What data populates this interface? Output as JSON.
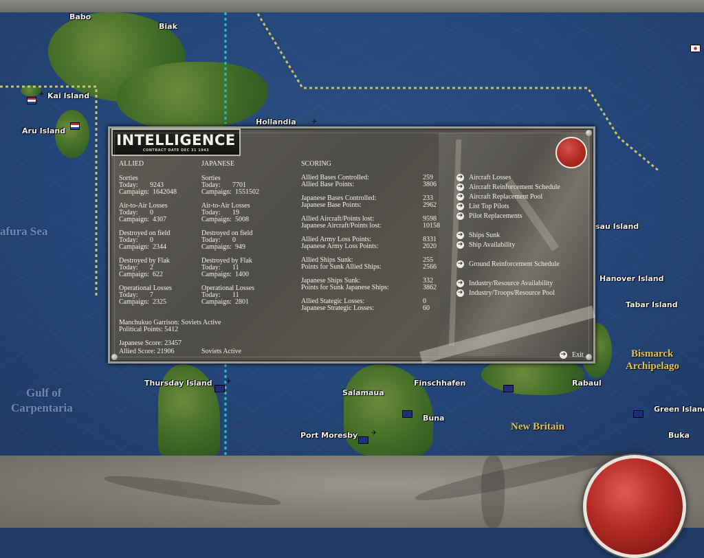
{
  "map": {
    "labels": {
      "babo": "Babo",
      "biak": "Biak",
      "kai_island": "Kai Island",
      "aru_island": "Aru Island",
      "hollandia": "Hollandia",
      "arafura_sea": "afura Sea",
      "thursday_island": "Thursday Island",
      "gulf_of_carpentaria_1": "Gulf of",
      "gulf_of_carpentaria_2": "Carpentaria",
      "salamaua": "Salamaua",
      "finschhafen": "Finschhafen",
      "buna": "Buna",
      "port_moresby": "Port Moresby",
      "new_britain": "New Britain",
      "rabaul": "Rabaul",
      "green_island": "Green Island",
      "buka": "Buka",
      "hanover_island": "Hanover Island",
      "tabar_island": "Tabar Island",
      "bismarck_1": "Bismarck",
      "bismarck_2": "Archipelago",
      "manus_island": "sau Island"
    }
  },
  "dialog": {
    "title": "INTELLIGENCE",
    "subtitle": "CONTRACT DATE DEC 31 1943",
    "allied": {
      "header": "ALLIED",
      "sorties_label": "Sorties",
      "sorties_today": "9243",
      "sorties_campaign": "1642048",
      "a2a_label": "Air-to-Air Losses",
      "a2a_today": "0",
      "a2a_campaign": "4307",
      "dof_label": "Destroyed on field",
      "dof_today": "0",
      "dof_campaign": "2344",
      "flak_label": "Destroyed by Flak",
      "flak_today": "2",
      "flak_campaign": "622",
      "ops_label": "Operational Losses",
      "ops_today": "7",
      "ops_campaign": "2325"
    },
    "japanese": {
      "header": "JAPANESE",
      "sorties_label": "Sorties",
      "sorties_today": "7701",
      "sorties_campaign": "1551502",
      "a2a_label": "Air-to-Air Losses",
      "a2a_today": "19",
      "a2a_campaign": "5008",
      "dof_label": "Destroyed on field",
      "dof_today": "0",
      "dof_campaign": "949",
      "flak_label": "Destroyed by Flak",
      "flak_today": "11",
      "flak_campaign": "1400",
      "ops_label": "Operational Losses",
      "ops_today": "11",
      "ops_campaign": "2801"
    },
    "today_label": "Today:",
    "campaign_label": "Campaign:",
    "manchukuo": "Manchukuo Garrison: Soviets Active",
    "political_points": "Political Points: 5412",
    "japanese_score": "Japanese Score: 23457",
    "allied_score": "Allied Score: 21906",
    "soviets_active": "Soviets Active",
    "scoring": {
      "header": "SCORING",
      "rows": [
        {
          "label": "Allied Bases Controlled:",
          "value": "259"
        },
        {
          "label": "Allied Base Points:",
          "value": "3806"
        },
        {
          "label": "Japanese Bases Controlled:",
          "value": "233"
        },
        {
          "label": "Japanese Base Points:",
          "value": "2962"
        },
        {
          "label": "Allied Aircraft/Points lost:",
          "value": "9598"
        },
        {
          "label": "Japanese Aircraft/Points lost:",
          "value": "10158"
        },
        {
          "label": "Allied Army Loss Points:",
          "value": "8331"
        },
        {
          "label": "Japanese Army Loss Points:",
          "value": "2020"
        },
        {
          "label": "Allied Ships Sunk:",
          "value": "255"
        },
        {
          "label": "Points for Sunk Allied Ships:",
          "value": "2566"
        },
        {
          "label": "Japanese Ships Sunk:",
          "value": "332"
        },
        {
          "label": "Points for Sunk Japanese Ships:",
          "value": "3862"
        },
        {
          "label": "Allied Stategic Losses:",
          "value": "0"
        },
        {
          "label": "Japanese Strategic Losses:",
          "value": "60"
        }
      ]
    },
    "menu": [
      "Aircraft Losses",
      "Aircraft Reinforcement Schedule",
      "Aircraft Replacement Pool",
      "List Top Pilots",
      "Pilot Replacements",
      "Ships Sunk",
      "Ship Availability",
      "Ground Reinforcement Schedule",
      "Industry/Resource Availability",
      "Industry/Troops/Resource Pool"
    ],
    "exit_label": "Exit"
  }
}
